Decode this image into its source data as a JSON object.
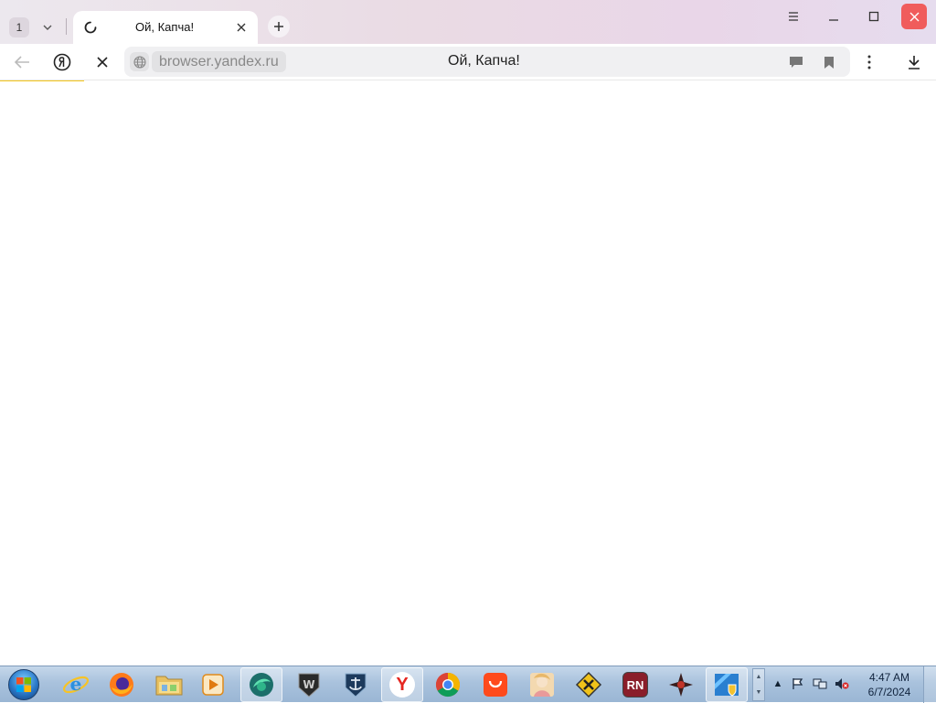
{
  "browser": {
    "tab_count": "1",
    "tab": {
      "title": "Ой, Капча!"
    },
    "address_bar": {
      "domain": "browser.yandex.ru",
      "page_title": "Ой, Капча!"
    },
    "loading_progress": 0.09,
    "accent_color": "#f5c518"
  },
  "taskbar": {
    "pinned": [
      {
        "name": "internet-explorer",
        "icon": "ie-icon"
      },
      {
        "name": "firefox",
        "icon": "firefox-icon"
      },
      {
        "name": "file-explorer",
        "icon": "folder-icon"
      },
      {
        "name": "media-player",
        "icon": "play-icon"
      },
      {
        "name": "app-green",
        "icon": "green-app-icon"
      },
      {
        "name": "world-of-tanks",
        "icon": "tanks-icon"
      },
      {
        "name": "world-of-warships",
        "icon": "anchor-icon"
      },
      {
        "name": "yandex-browser",
        "icon": "yandex-icon",
        "glyph": "Y"
      },
      {
        "name": "chrome",
        "icon": "chrome-icon"
      },
      {
        "name": "aliexpress",
        "icon": "aliexpress-icon"
      },
      {
        "name": "game-character",
        "icon": "character-icon"
      },
      {
        "name": "game-yellow",
        "icon": "yellow-game-icon"
      },
      {
        "name": "rn-app",
        "icon": "rn-icon",
        "glyph": "RN"
      },
      {
        "name": "game-star",
        "icon": "star-game-icon"
      },
      {
        "name": "control-panel",
        "icon": "control-panel-icon"
      }
    ],
    "clock": {
      "time": "4:47 AM",
      "date": "6/7/2024"
    }
  }
}
